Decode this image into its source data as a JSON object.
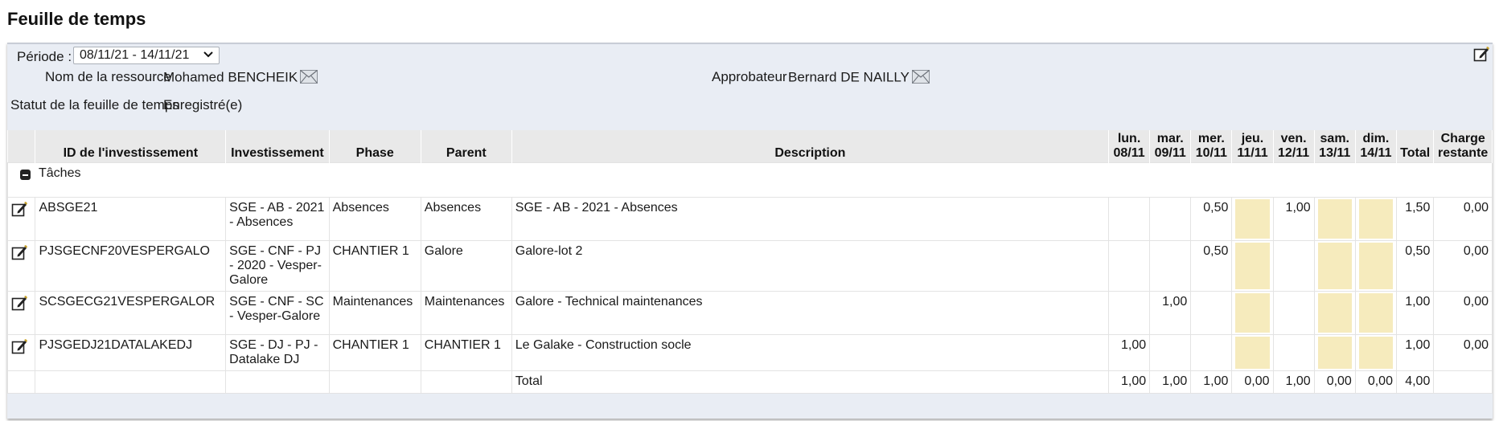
{
  "page_title": "Feuille de temps",
  "period": {
    "label": "Période :",
    "value": "08/11/21 - 14/11/21"
  },
  "resource": {
    "label": "Nom de la ressource",
    "value": "Mohamed BENCHEIK"
  },
  "approver": {
    "label": "Approbateur",
    "value": "Bernard DE NAILLY"
  },
  "status": {
    "label": "Statut de la feuille de temps",
    "value": "Enregistré(e)"
  },
  "columns": {
    "id": "ID de l'investissement",
    "investment": "Investissement",
    "phase": "Phase",
    "parent": "Parent",
    "description": "Description",
    "days": [
      {
        "day": "lun.",
        "date": "08/11"
      },
      {
        "day": "mar.",
        "date": "09/11"
      },
      {
        "day": "mer.",
        "date": "10/11"
      },
      {
        "day": "jeu.",
        "date": "11/11"
      },
      {
        "day": "ven.",
        "date": "12/11"
      },
      {
        "day": "sam.",
        "date": "13/11"
      },
      {
        "day": "dim.",
        "date": "14/11"
      }
    ],
    "total": "Total",
    "remaining_1": "Charge",
    "remaining_2": "restante"
  },
  "group_label": "Tâches",
  "rows": [
    {
      "id": "ABSGE21",
      "investment": "SGE - AB - 2021 - Absences",
      "phase": "Absences",
      "parent": "Absences",
      "description": "SGE - AB - 2021 - Absences",
      "days": [
        "",
        "",
        "0,50",
        "",
        "1,00",
        "",
        ""
      ],
      "total": "1,50",
      "remaining": "0,00"
    },
    {
      "id": "PJSGECNF20VESPERGALO",
      "investment": "SGE - CNF - PJ - 2020 - Vesper-Galore",
      "phase": "CHANTIER 1",
      "parent": "Galore",
      "description": "Galore-lot 2",
      "days": [
        "",
        "",
        "0,50",
        "",
        "",
        "",
        ""
      ],
      "total": "0,50",
      "remaining": "0,00"
    },
    {
      "id": "SCSGECG21VESPERGALOR",
      "investment": "SGE - CNF - SC - Vesper-Galore",
      "phase": "Maintenances",
      "parent": "Maintenances",
      "description": "Galore - Technical maintenances",
      "days": [
        "",
        "1,00",
        "",
        "",
        "",
        "",
        ""
      ],
      "total": "1,00",
      "remaining": "0,00"
    },
    {
      "id": "PJSGEDJ21DATALAKEDJ",
      "investment": "SGE - DJ - PJ - Datalake DJ",
      "phase": "CHANTIER 1",
      "parent": "CHANTIER 1",
      "description": "Le Galake - Construction socle",
      "days": [
        "1,00",
        "",
        "",
        "",
        "",
        "",
        ""
      ],
      "total": "1,00",
      "remaining": "0,00"
    }
  ],
  "totals": {
    "label": "Total",
    "days": [
      "1,00",
      "1,00",
      "1,00",
      "0,00",
      "1,00",
      "0,00",
      "0,00"
    ],
    "total": "4,00"
  },
  "icons": {
    "edit": "edit-icon",
    "envelope": "envelope-icon",
    "collapse": "collapse-icon"
  },
  "colors": {
    "weekend_cell": "#f6ebbd",
    "link": "#1f4e8c",
    "panel_bg": "#e9edf4",
    "header_bg": "#e9e9e9"
  }
}
